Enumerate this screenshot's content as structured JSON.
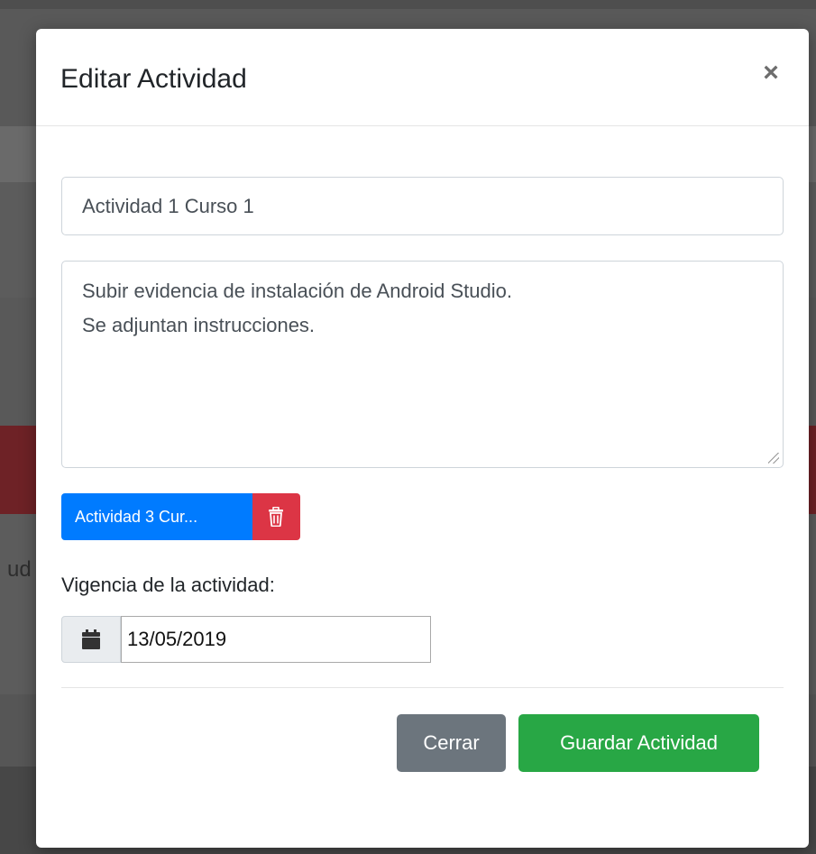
{
  "modal": {
    "title": "Editar Actividad",
    "close_symbol": "×"
  },
  "form": {
    "title_value": "Actividad 1 Curso 1",
    "description_value": "Subir evidencia de instalación de Android Studio.\nSe adjuntan instrucciones.",
    "attachment_label": "Actividad 3 Cur...",
    "validity_label": "Vigencia de la actividad:",
    "date_value": "13/05/2019"
  },
  "footer": {
    "close_label": "Cerrar",
    "save_label": "Guardar Actividad"
  },
  "background": {
    "partial_text": "ud"
  },
  "icons": {
    "close": "close-icon",
    "delete": "trash-icon",
    "date": "calendar-icon"
  },
  "colors": {
    "primary": "#007bff",
    "danger": "#dc3545",
    "secondary": "#6c757d",
    "success": "#28a745"
  }
}
